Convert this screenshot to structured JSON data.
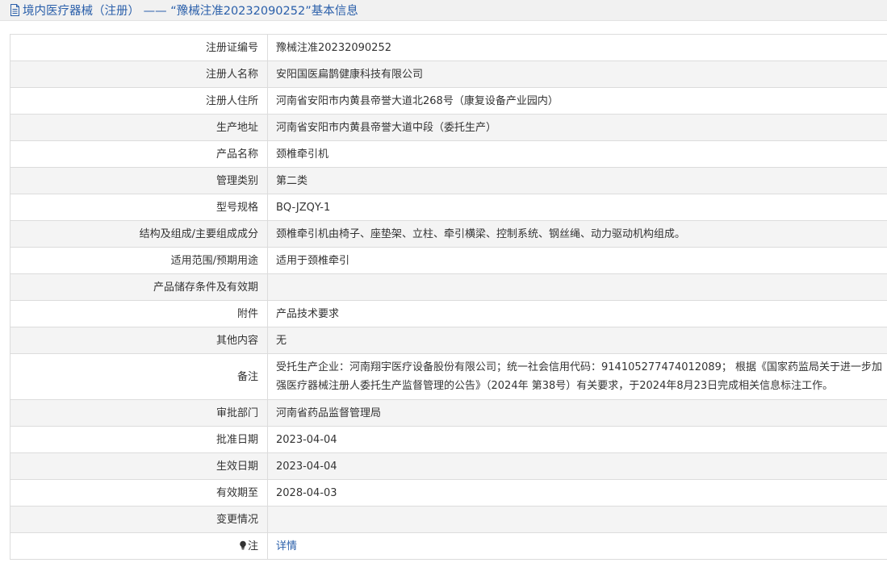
{
  "header": {
    "title": "境内医疗器械（注册） —— “豫械注准20232090252”基本信息"
  },
  "rows": [
    {
      "label": "注册证编号",
      "value": "豫械注准20232090252"
    },
    {
      "label": "注册人名称",
      "value": "安阳国医扁鹊健康科技有限公司"
    },
    {
      "label": "注册人住所",
      "value": "河南省安阳市内黄县帝誉大道北268号（康复设备产业园内）"
    },
    {
      "label": "生产地址",
      "value": "河南省安阳市内黄县帝誉大道中段（委托生产）"
    },
    {
      "label": "产品名称",
      "value": "颈椎牵引机"
    },
    {
      "label": "管理类别",
      "value": "第二类"
    },
    {
      "label": "型号规格",
      "value": "BQ-JZQY-1"
    },
    {
      "label": "结构及组成/主要组成成分",
      "value": "颈椎牵引机由椅子、座垫架、立柱、牵引横梁、控制系统、钢丝绳、动力驱动机构组成。"
    },
    {
      "label": "适用范围/预期用途",
      "value": "适用于颈椎牵引"
    },
    {
      "label": "产品储存条件及有效期",
      "value": ""
    },
    {
      "label": "附件",
      "value": "产品技术要求"
    },
    {
      "label": "其他内容",
      "value": "无"
    },
    {
      "label": "备注",
      "value": "受托生产企业：河南翔宇医疗设备股份有限公司；统一社会信用代码：914105277474012089； 根据《国家药监局关于进一步加强医疗器械注册人委托生产监督管理的公告》（2024年 第38号）有关要求，于2024年8月23日完成相关信息标注工作。"
    },
    {
      "label": "审批部门",
      "value": "河南省药品监督管理局"
    },
    {
      "label": "批准日期",
      "value": "2023-04-04"
    },
    {
      "label": "生效日期",
      "value": "2023-04-04"
    },
    {
      "label": "有效期至",
      "value": "2028-04-03"
    },
    {
      "label": "变更情况",
      "value": ""
    },
    {
      "label": "注",
      "value": "详情"
    }
  ],
  "icons": {
    "header_icon": "document-icon",
    "note_icon": "lightbulb-icon"
  },
  "colors": {
    "link": "#2a5faa",
    "header_bg": "#f1f1f1",
    "alt_row_bg": "#f4f4f4",
    "border": "#dcdcdc",
    "text": "#333333"
  }
}
